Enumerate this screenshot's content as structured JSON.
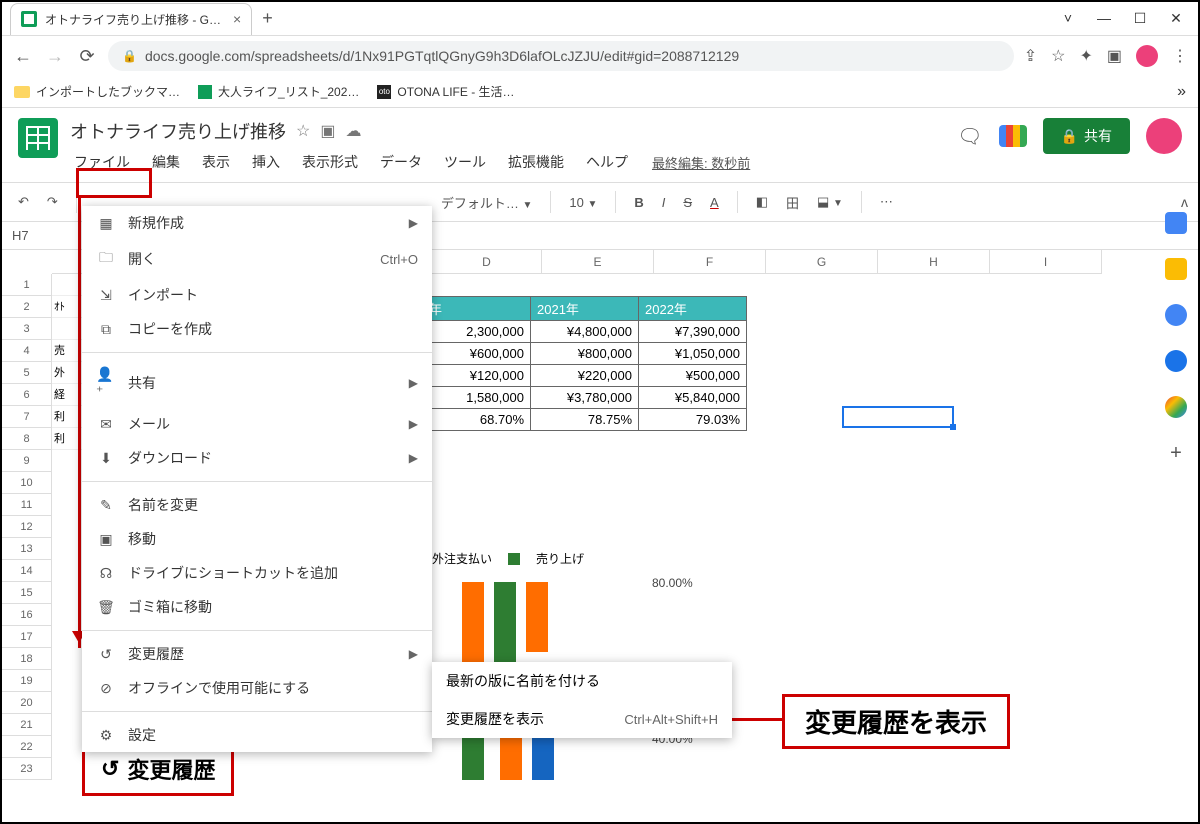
{
  "browser": {
    "tab_title": "オトナライフ売り上げ推移 - Google",
    "url": "docs.google.com/spreadsheets/d/1Nx91PGTqtlQGnyG9h3D6lafOLcJZJU/edit#gid=2088712129"
  },
  "bookmarks": {
    "b1": "インポートしたブックマ…",
    "b2": "大人ライフ_リスト_202…",
    "b3": "OTONA LIFE - 生活…"
  },
  "doc": {
    "title": "オトナライフ売り上げ推移",
    "last_edit": "最終編集: 数秒前"
  },
  "menubar": {
    "file": "ファイル",
    "edit": "編集",
    "view": "表示",
    "insert": "挿入",
    "format": "表示形式",
    "data": "データ",
    "tools": "ツール",
    "ext": "拡張機能",
    "help": "ヘルプ"
  },
  "share_btn": "共有",
  "toolbar": {
    "font": "デフォルト…",
    "size": "10"
  },
  "cell_ref": "H7",
  "cols": {
    "d": "D",
    "e": "E",
    "f": "F",
    "g": "G",
    "h": "H",
    "i": "I"
  },
  "rows": [
    "1",
    "2",
    "3",
    "4",
    "5",
    "6",
    "7",
    "8",
    "9",
    "10",
    "11",
    "12",
    "13",
    "14",
    "15",
    "16",
    "17",
    "18",
    "19",
    "20",
    "21",
    "22",
    "23"
  ],
  "rowlabels": {
    "r2": "ｵﾄ",
    "r4": "売",
    "r5": "外",
    "r6": "経",
    "r7": "利",
    "r8": "利"
  },
  "table": {
    "h1": "年",
    "h2": "2021年",
    "h3": "2022年",
    "r1c1": "2,300,000",
    "r1c2": "¥4,800,000",
    "r1c3": "¥7,390,000",
    "r2c1": "¥600,000",
    "r2c2": "¥800,000",
    "r2c3": "¥1,050,000",
    "r3c1": "¥120,000",
    "r3c2": "¥220,000",
    "r3c3": "¥500,000",
    "r4c1": "1,580,000",
    "r4c2": "¥3,780,000",
    "r4c3": "¥5,840,000",
    "r5c1": "68.70%",
    "r5c2": "78.75%",
    "r5c3": "79.03%"
  },
  "file_menu": {
    "new": "新規作成",
    "open": "開く",
    "open_sc": "Ctrl+O",
    "import": "インポート",
    "copy": "コピーを作成",
    "share": "共有",
    "email": "メール",
    "download": "ダウンロード",
    "rename": "名前を変更",
    "move": "移動",
    "shortcut": "ドライブにショートカットを追加",
    "trash": "ゴミ箱に移動",
    "history": "変更履歴",
    "offline": "オフラインで使用可能にする",
    "settings": "設定"
  },
  "submenu": {
    "name_ver": "最新の版に名前を付ける",
    "show_hist": "変更履歴を表示",
    "show_hist_sc": "Ctrl+Alt+Shift+H"
  },
  "callout": {
    "history": "変更履歴",
    "show": "変更履歴を表示"
  },
  "legend": {
    "l1": "外注支払い",
    "l2": "売り上げ"
  },
  "pct": {
    "p80": "80.00%",
    "p40": "40.00%"
  },
  "chart_data": {
    "type": "bar",
    "series": [
      {
        "name": "外注支払い",
        "color": "#ff6d00"
      },
      {
        "name": "売り上げ",
        "color": "#2e7d32"
      }
    ],
    "secondary_axis_pct": [
      80.0,
      40.0
    ]
  }
}
